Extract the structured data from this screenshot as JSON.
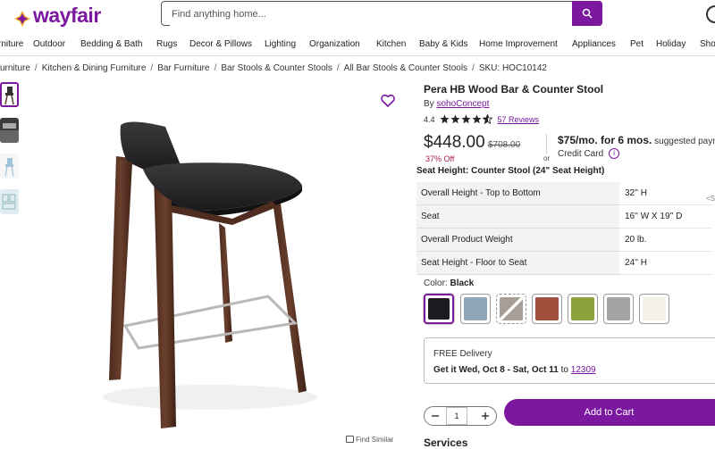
{
  "header": {
    "logo": "wayfair",
    "search_placeholder": "Find anything home...",
    "brand_color": "#7b189f"
  },
  "nav": {
    "items": [
      "rniture",
      "Outdoor",
      "Bedding & Bath",
      "Rugs",
      "Decor & Pillows",
      "Lighting",
      "Organization",
      "Kitchen",
      "Baby & Kids",
      "Home Improvement",
      "Appliances",
      "Pet",
      "Holiday",
      "Sho"
    ]
  },
  "breadcrumb": {
    "items": [
      "urniture",
      "Kitchen & Dining Furniture",
      "Bar Furniture",
      "Bar Stools & Counter Stools",
      "All Bar Stools & Counter Stools"
    ],
    "sku": "SKU: HOC10142"
  },
  "gallery": {
    "find_similar": "Find Similar",
    "thumb_icons": [
      "stool-thumb",
      "room-thumb",
      "blue-stool-thumb",
      "dimension-thumb"
    ]
  },
  "product": {
    "title": "Pera HB Wood Bar & Counter Stool",
    "by": "By",
    "brand": "sohoConcept",
    "rating": "4.4",
    "stars_filled": 4.4,
    "reviews": "57 Reviews",
    "price": "$448.00",
    "was_price": "$708.00",
    "discount": "37% Off",
    "or": "or",
    "financing": "$75/mo. for 6 mos.",
    "financing_suffix": " suggested paym",
    "credit_card": "Credit Card",
    "info_glyph": "i",
    "seat_height_label": "Seat Height: Counter Stool (24\" Seat Height)"
  },
  "specs": [
    {
      "label": "Overall Height - Top to Bottom",
      "value": "32'' H"
    },
    {
      "label": "Seat",
      "value": "16'' W X 19'' D"
    },
    {
      "label": "Overall Product Weight",
      "value": "20 lb."
    },
    {
      "label": "Seat Height - Floor to Seat",
      "value": "24'' H"
    }
  ],
  "color": {
    "label": "Color:",
    "selected": "Black",
    "swatches": [
      "#1c1b22",
      "#8ea6b8",
      "#a79f95",
      "#a0503a",
      "#8ca23a",
      "#a5a3a4",
      "#f3f1e5"
    ]
  },
  "delivery": {
    "title": "FREE Delivery",
    "get_it": "Get it Wed, Oct 8 - Sat, Oct 11",
    "to": "to",
    "zip": "12309"
  },
  "cart": {
    "qty": "1",
    "add_label": "Add to Cart"
  },
  "services": "Services",
  "edge_glyph": "<S"
}
